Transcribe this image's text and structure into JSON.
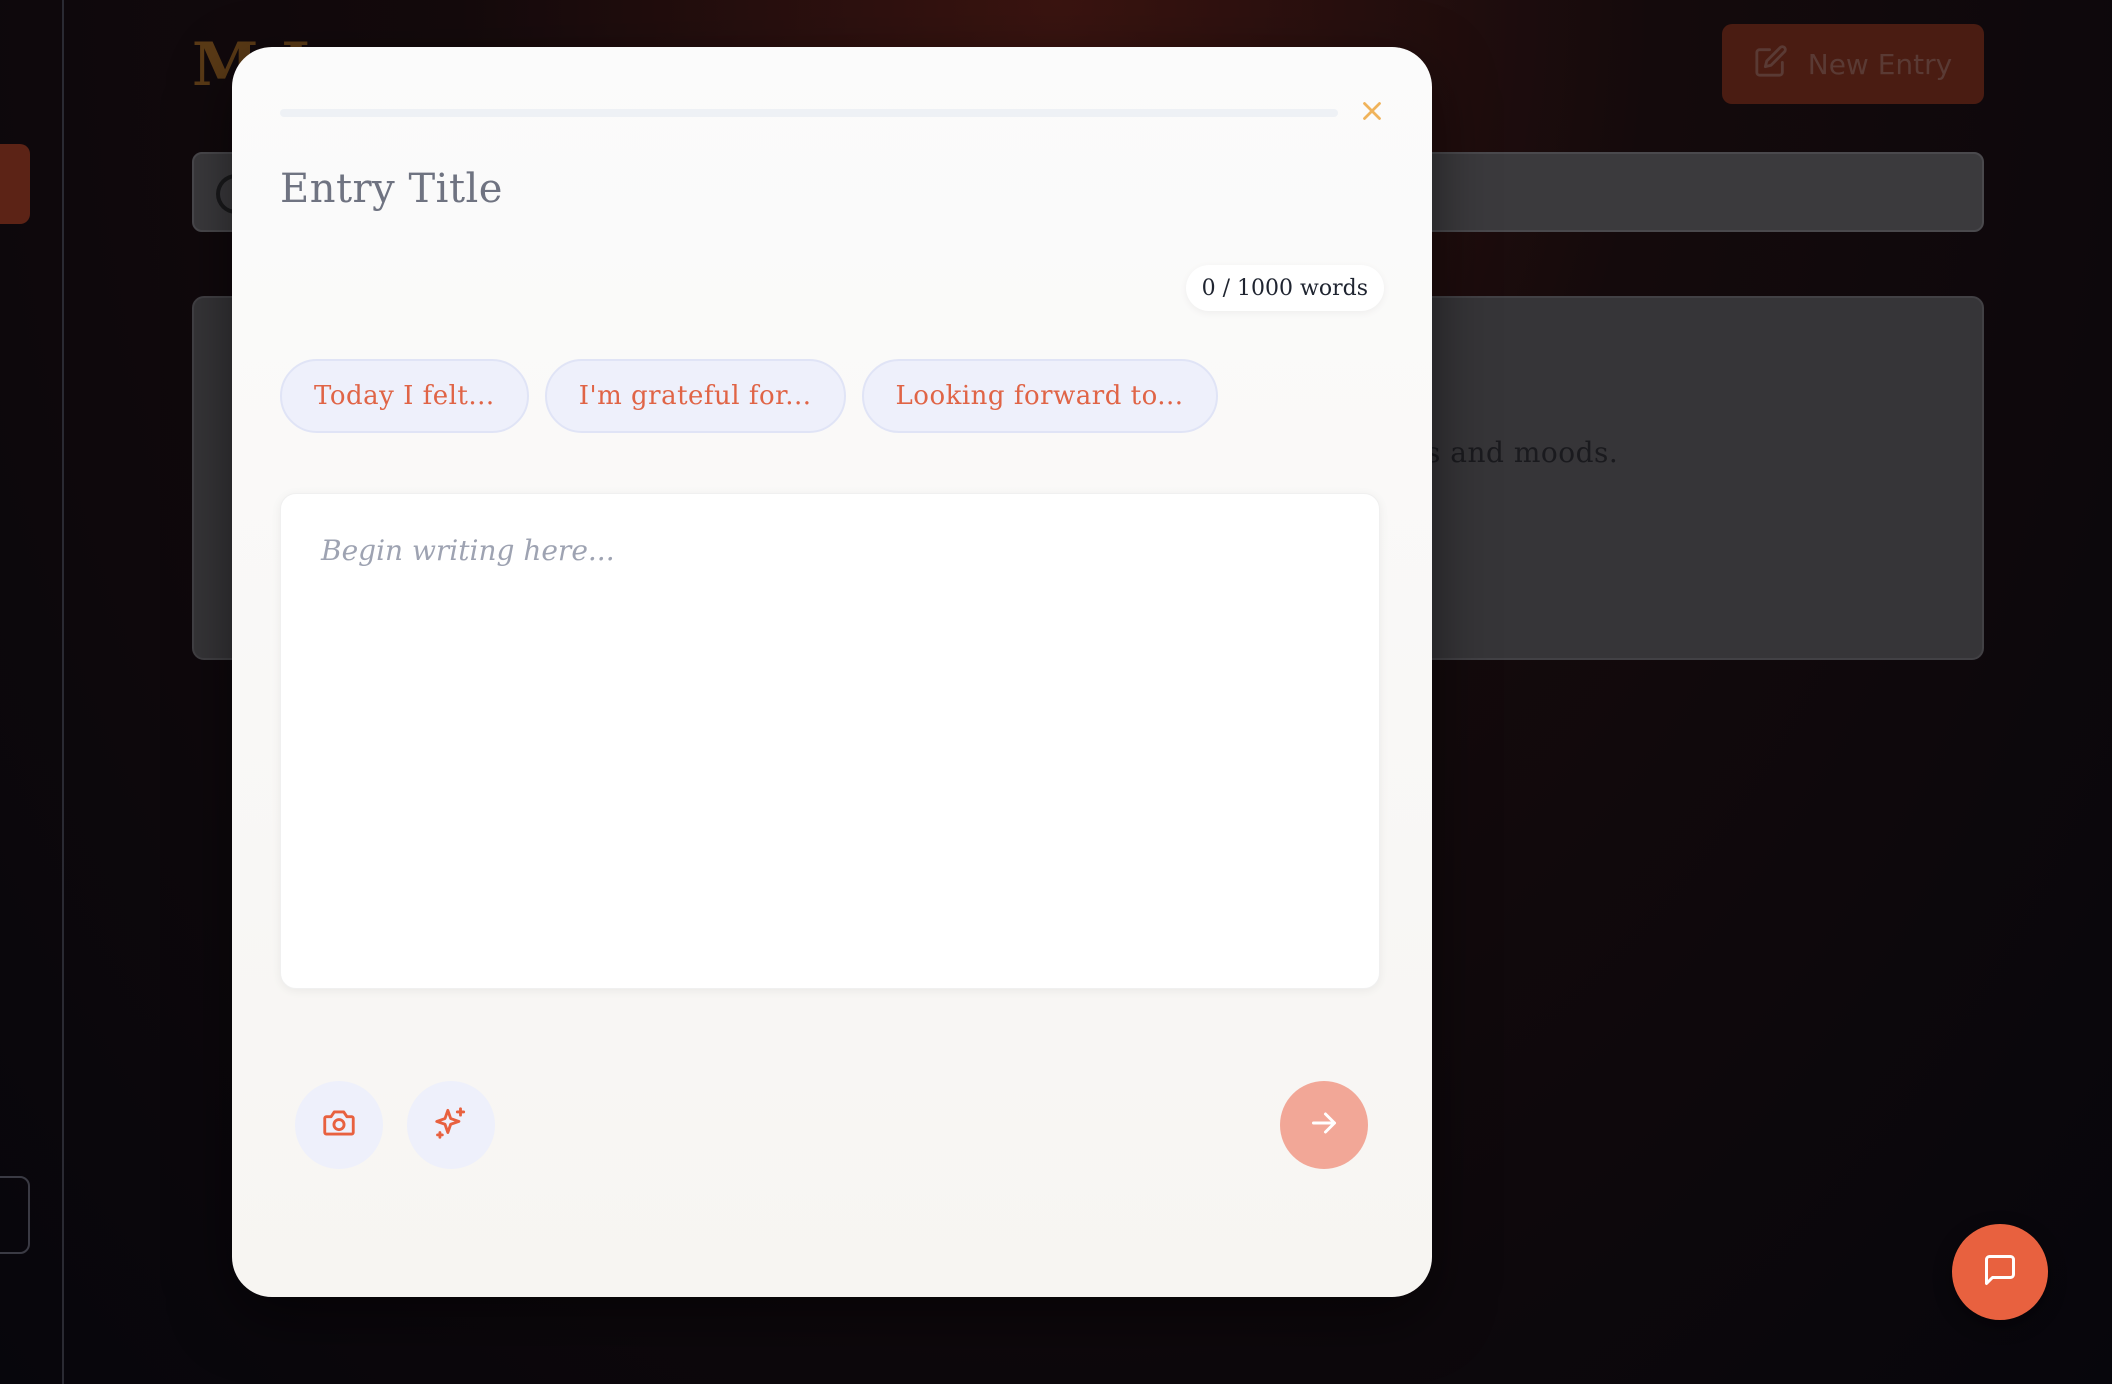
{
  "background": {
    "heading": "M          J",
    "new_entry_label": "New Entry",
    "card_text_visible": "s and moods."
  },
  "modal": {
    "title_placeholder": "Entry Title",
    "word_count": "0 / 1000 words",
    "progress_fraction": 0,
    "prompts": [
      "Today I felt...",
      "I'm grateful for...",
      "Looking forward to..."
    ],
    "editor_placeholder": "Begin writing here...",
    "icons": {
      "close": "close-icon",
      "camera": "camera-icon",
      "sparkle": "sparkles-icon",
      "submit": "arrow-right-icon"
    }
  },
  "colors": {
    "accent": "#E8613F",
    "close_icon": "#F0B35A",
    "chip_bg": "#EEF0FB",
    "submit_disabled": "#F2A797"
  }
}
